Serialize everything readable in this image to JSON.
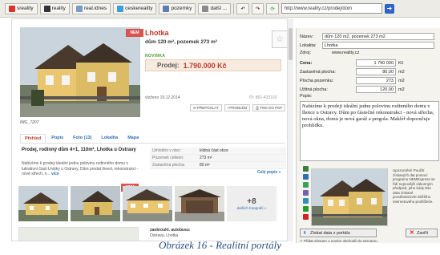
{
  "toolbar": {
    "buttons": [
      {
        "label": "sreality",
        "icon": "sreality-icon"
      },
      {
        "label": "reality",
        "icon": "reality-icon"
      },
      {
        "label": "real.idnes",
        "icon": "idnes-icon"
      },
      {
        "label": "ceskereality",
        "icon": "ceskereality-icon"
      },
      {
        "label": "pozemky",
        "icon": "pozemky-icon"
      },
      {
        "label": "další ...",
        "icon": "more-icon"
      }
    ],
    "url": "http://www.reality.cz/prodej/dom"
  },
  "listing": {
    "title": "Lhotka",
    "subtitle": "dům 120 m², pozemek 273 m²",
    "badge": "NOVINKA",
    "price_label": "Prodej:",
    "price_value": "1.790.000 Kč",
    "listed": "vloženo 19.12.2014",
    "listing_id": "ID: 861-433160",
    "actions": [
      "PŘEPOSLAT",
      "PROBLÉM",
      "TISK DO PDF"
    ],
    "photo_caption": "IMG_7207",
    "tabs": [
      "Přehled",
      "Popis",
      "Foto (13)",
      "Lokalita",
      "Mapa"
    ],
    "desc_title": "Prodej, rodinný dům 4+1, 110m², Lhotka u Ostravy",
    "desc_text": "Nabízíme k prodeji ideální jednu polovinu rodinného domu v lukrativní části Lhotky u Ostravy. Dům prodat ihned, rekonstrukcí - nové střech, n...",
    "desc_more": "více",
    "params": [
      {
        "k": "Umístění v obci:",
        "v": "klidná část obce"
      },
      {
        "k": "Pozemek celkem:",
        "v": "273 m²"
      },
      {
        "k": "Zastavěná plocha:",
        "v": "80 m²"
      }
    ],
    "all_params": "Celý popis »",
    "more_photos_count": "+8",
    "more_photos_label": "dalších fotografií »",
    "contact_title": "zaokrouhl. autobusu:",
    "contact_addr": "Ostrava, Lhotka"
  },
  "panel": {
    "fields": [
      {
        "label": "Název:",
        "value": "dům 120 m2, pozemek 273 m2"
      },
      {
        "label": "Lokalita:",
        "value": "Lhotka"
      },
      {
        "label": "Zdroj:",
        "value": "www.reality.cz"
      },
      {
        "label": "Cena:",
        "value": "1 790 000",
        "unit": "Kč"
      },
      {
        "label": "Zastavěná plocha:",
        "value": "80,00",
        "unit": "m2"
      },
      {
        "label": "Plocha pozemku:",
        "value": "273",
        "unit": "m2"
      },
      {
        "label": "Užitná plocha:",
        "value": "120,00",
        "unit": "m2"
      }
    ],
    "notes_label": "Popis:",
    "notes_text": "Nabízíme k prodeji ideální jednu polovinu rodinného domu v lhotce u Ostravy. Dům po částečné rekonstrukci - nová střecha, nová okna, domu je nová garáž a pergola. Makléř doporučuje prohlídku.",
    "warning": "Upozornění! Použití získaných dat pomocí programu NEMExpress se řídí nejnovější zákonným předpisů, jeho kódy této data získané prostřednictvím bližšího internetového prohlížeče.",
    "get_button": "Získat data z portálu",
    "close_button": "Zavřít",
    "footer": "Přidat záznam o novém obchodě do seznamu"
  },
  "caption": "Obrázek 16 - Realitní portály",
  "colors": {
    "accent": "#c0392b",
    "link": "#2f6fb4",
    "caption": "#2b4f7e"
  }
}
